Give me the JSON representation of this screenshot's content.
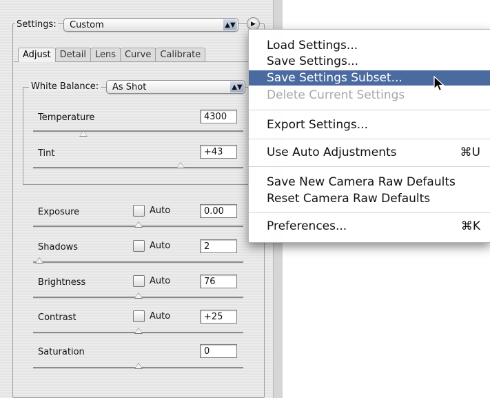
{
  "settings": {
    "label": "Settings:",
    "value": "Custom",
    "popup_arrows": "▲▼",
    "menu_button_icon": "▶"
  },
  "tabs": [
    "Adjust",
    "Detail",
    "Lens",
    "Curve",
    "Calibrate"
  ],
  "white_balance": {
    "label": "White Balance:",
    "value": "As Shot"
  },
  "temperature": {
    "label": "Temperature",
    "value": "4300",
    "slider_fraction": 0.24
  },
  "tint": {
    "label": "Tint",
    "value": "+43",
    "slider_fraction": 0.7
  },
  "exposure": {
    "label": "Exposure",
    "auto_label": "Auto",
    "value": "0.00",
    "slider_fraction": 0.5
  },
  "shadows": {
    "label": "Shadows",
    "auto_label": "Auto",
    "value": "2",
    "slider_fraction": 0.03
  },
  "brightness": {
    "label": "Brightness",
    "auto_label": "Auto",
    "value": "76",
    "slider_fraction": 0.5
  },
  "contrast": {
    "label": "Contrast",
    "auto_label": "Auto",
    "value": "+25",
    "slider_fraction": 0.5
  },
  "saturation": {
    "label": "Saturation",
    "value": "0",
    "slider_fraction": 0.5
  },
  "menu": {
    "items": [
      {
        "label": "Load Settings...",
        "shortcut": ""
      },
      {
        "label": "Save Settings...",
        "shortcut": ""
      },
      {
        "label": "Save Settings Subset...",
        "shortcut": ""
      },
      {
        "label": "Delete Current Settings",
        "shortcut": ""
      },
      {
        "label": "Export Settings...",
        "shortcut": ""
      },
      {
        "label": "Use Auto Adjustments",
        "shortcut": "⌘U"
      },
      {
        "label": "Save New Camera Raw Defaults",
        "shortcut": ""
      },
      {
        "label": "Reset Camera Raw Defaults",
        "shortcut": ""
      },
      {
        "label": "Preferences...",
        "shortcut": "⌘K"
      }
    ],
    "highlighted": "Save Settings Subset...",
    "disabled": "Delete Current Settings"
  },
  "colors": {
    "highlight": "#4a6aa0",
    "panel": "#ececec"
  }
}
